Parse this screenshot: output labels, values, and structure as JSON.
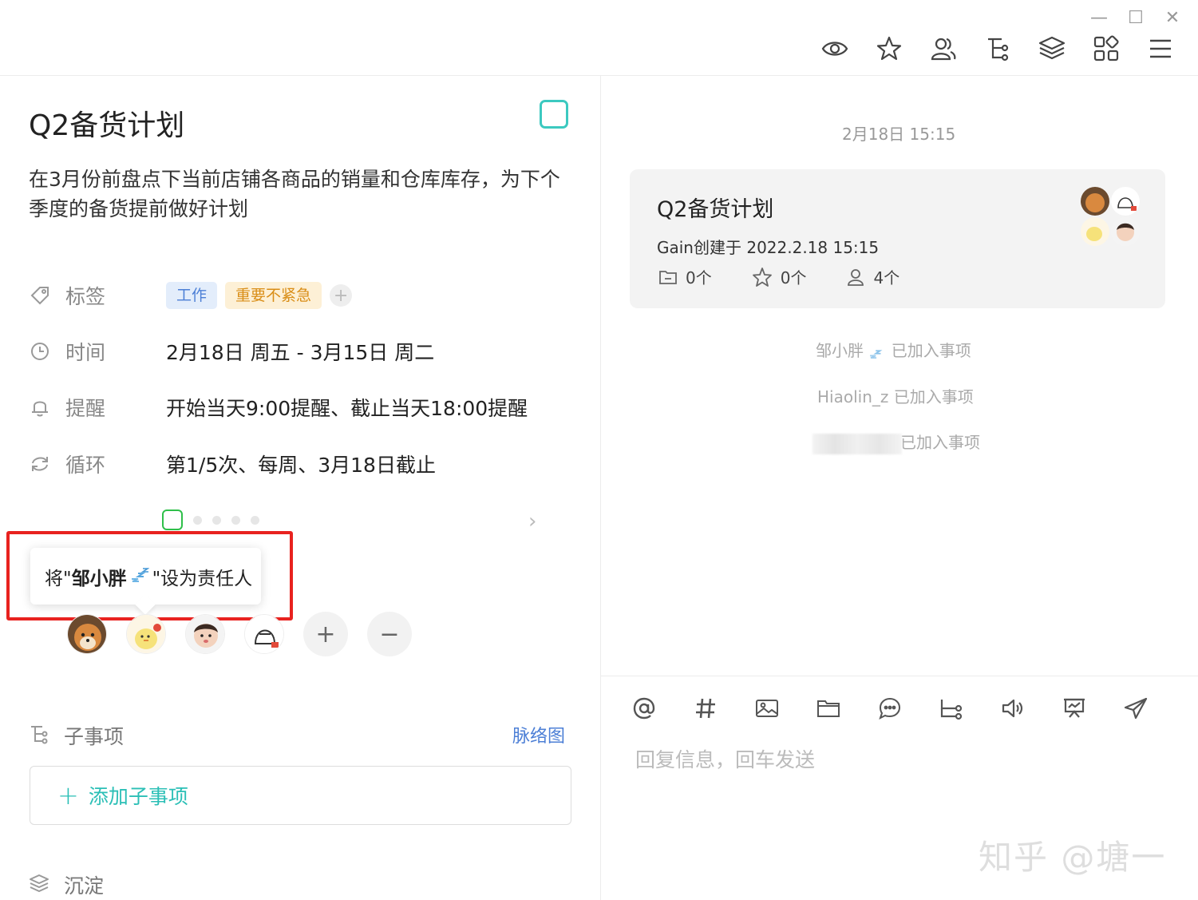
{
  "window": {
    "minimize": "—",
    "maximize": "☐",
    "close": "✕"
  },
  "toolbar": [
    "eye-icon",
    "star-icon",
    "members-icon",
    "tree-icon",
    "layers-icon",
    "apps-icon",
    "menu-icon"
  ],
  "task": {
    "title": "Q2备货计划",
    "description": "在3月份前盘点下当前店铺各商品的销量和仓库库存，为下个季度的备货提前做好计划",
    "fields": {
      "tags_label": "标签",
      "tags": [
        "工作",
        "重要不紧急"
      ],
      "time_label": "时间",
      "time_value": "2月18日 周五  -  3月15日 周二",
      "remind_label": "提醒",
      "remind_value": "开始当天9:00提醒、截止当天18:00提醒",
      "repeat_label": "循环",
      "repeat_value": "第1/5次、每周、3月18日截止"
    },
    "repeat_progress": {
      "current": 1,
      "total": 5
    },
    "tooltip": {
      "prefix": "将\"",
      "name": "邹小胖",
      "suffix": "\"设为责任人"
    },
    "subtasks_label": "子事项",
    "subtasks_link": "脉络图",
    "add_subtask": "添加子事项",
    "sediment_label": "沉淀"
  },
  "colors": {
    "accent": "#2bbfb6",
    "link": "#4c7fd6",
    "highlight_box": "#e8221f",
    "progress": "#2fbf4a"
  },
  "chat": {
    "timestamp": "2月18日 15:15",
    "card": {
      "title": "Q2备货计划",
      "subtitle": "Gain创建于 2022.2.18 15:15",
      "files": "0个",
      "stars": "0个",
      "members": "4个"
    },
    "system_messages": [
      {
        "name": "邹小胖",
        "text": "已加入事项"
      },
      {
        "name": "Hiaolin_z",
        "text": "已加入事项"
      },
      {
        "name": "",
        "text": "已加入事项"
      }
    ],
    "reply_placeholder": "回复信息，回车发送"
  },
  "watermark": "知乎 @塘一"
}
